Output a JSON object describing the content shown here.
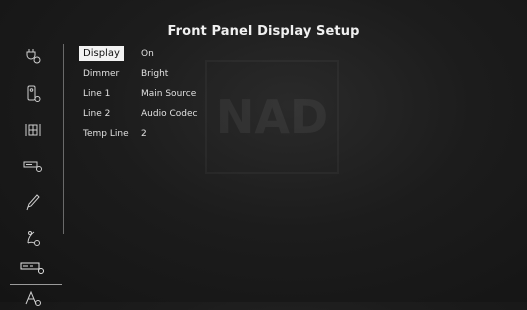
{
  "screen": {
    "title": "Front Panel Display Setup",
    "watermark": "NAD"
  },
  "sidebar": {
    "items": [
      {
        "icon": "input-plug-icon"
      },
      {
        "icon": "remote-control-icon"
      },
      {
        "icon": "speaker-grid-icon"
      },
      {
        "icon": "amplifier-settings-icon"
      },
      {
        "icon": "pencil-settings-icon"
      },
      {
        "icon": "listening-mode-icon"
      },
      {
        "icon": "front-panel-display-icon",
        "selected": true
      },
      {
        "icon": "tuner-settings-icon"
      }
    ]
  },
  "settings": {
    "rows": [
      {
        "label": "Display",
        "value": "On"
      },
      {
        "label": "Dimmer",
        "value": "Bright"
      },
      {
        "label": "Line 1",
        "value": "Main Source"
      },
      {
        "label": "Line 2",
        "value": "Audio Codec"
      },
      {
        "label": "Temp Line",
        "value": "2"
      }
    ]
  }
}
